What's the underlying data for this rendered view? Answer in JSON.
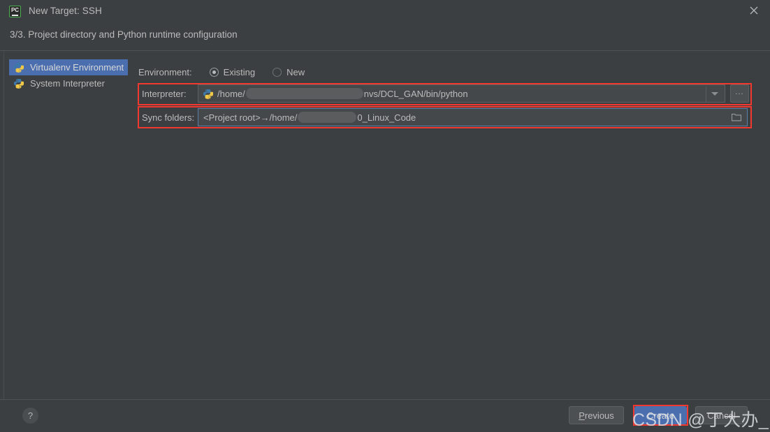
{
  "window": {
    "title": "New Target: SSH",
    "app_icon": "pycharm-icon",
    "close_label": "×"
  },
  "subtitle": "3/3. Project directory and Python runtime configuration",
  "sidebar": {
    "items": [
      {
        "label": "Virtualenv Environment",
        "icon": "python-virtualenv-icon",
        "selected": true
      },
      {
        "label": "System Interpreter",
        "icon": "python-icon",
        "selected": false
      }
    ]
  },
  "form": {
    "environment": {
      "label": "Environment:",
      "options": [
        {
          "label": "Existing",
          "selected": true
        },
        {
          "label": "New",
          "selected": false
        }
      ]
    },
    "interpreter": {
      "label": "Interpreter:",
      "icon": "python-icon",
      "value_prefix": "/home/",
      "value_suffix": "nvs/DCL_GAN/bin/python",
      "redacted": true,
      "dropdown_icon": "chevron-down-icon",
      "browse_label": "...",
      "highlighted": true
    },
    "sync_folders": {
      "label": "Sync folders:",
      "value_prefix": "<Project root>→/home/",
      "value_suffix": "0_Linux_Code",
      "redacted": true,
      "browse_icon": "folder-icon",
      "highlighted": true,
      "focused": true
    }
  },
  "footer": {
    "help_label": "?",
    "previous_label_prefix": "P",
    "previous_label_rest": "revious",
    "create_label": "Create",
    "cancel_label": "Cancel",
    "create_highlighted": true
  },
  "watermark": {
    "text": "CSDN @丁大办_DDL"
  },
  "colors": {
    "background": "#3c3f41",
    "selection_blue": "#4b6eaf",
    "highlight_red": "#f2382f",
    "field_background": "#45484a",
    "text": "#bbbbbb",
    "focus_border": "#5a7fa8"
  }
}
